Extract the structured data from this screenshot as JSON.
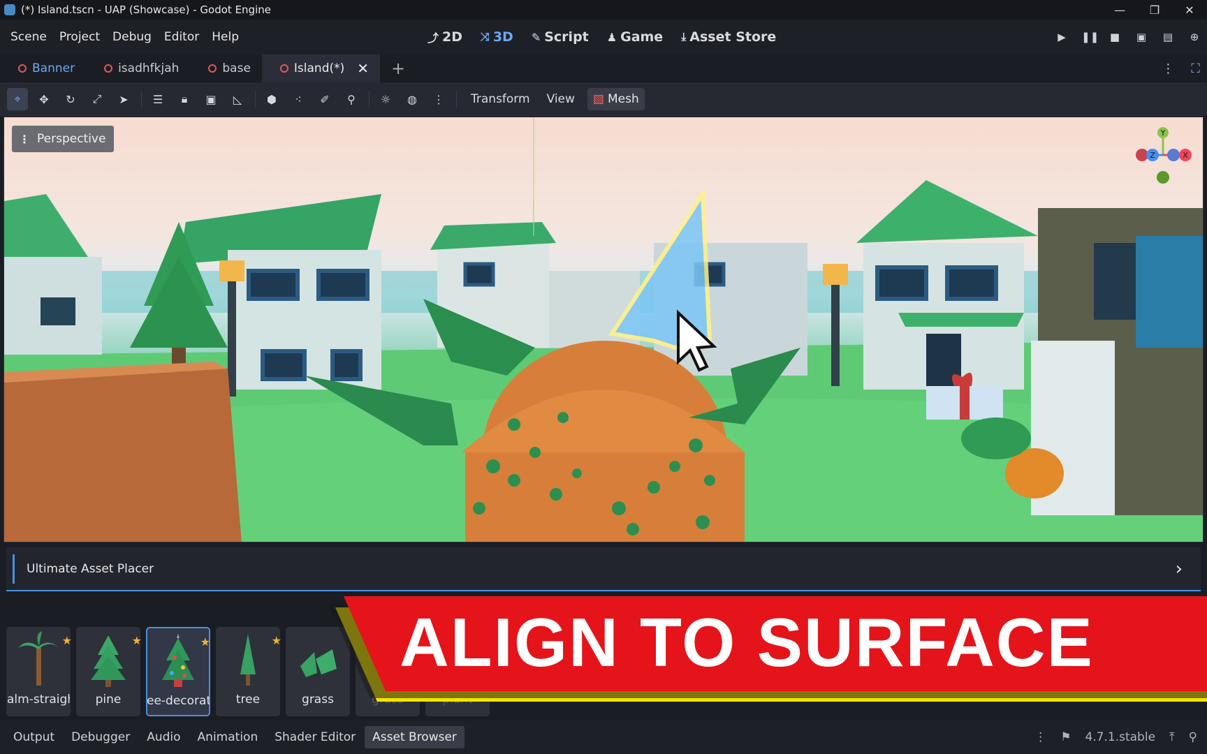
{
  "window": {
    "title": "(*) Island.tscn - UAP (Showcase) - Godot Engine"
  },
  "menu": [
    "Scene",
    "Project",
    "Debug",
    "Editor",
    "Help"
  ],
  "workspaces": [
    {
      "label": "2D",
      "icon": "2d-icon"
    },
    {
      "label": "3D",
      "icon": "3d-icon",
      "active": true
    },
    {
      "label": "Script",
      "icon": "script-icon"
    },
    {
      "label": "Game",
      "icon": "game-icon"
    },
    {
      "label": "Asset Store",
      "icon": "download-icon"
    }
  ],
  "scene_tabs": [
    {
      "label": "Banner"
    },
    {
      "label": "isadhfkjah"
    },
    {
      "label": "base"
    },
    {
      "label": "Island(*)",
      "active": true
    }
  ],
  "toolbar": {
    "transform_label": "Transform",
    "view_label": "View",
    "mesh_label": "Mesh"
  },
  "viewport": {
    "perspective_label": "Perspective",
    "gizmo": {
      "x": "X",
      "y": "Y",
      "z": "Z"
    }
  },
  "dock": {
    "title": "Ultimate Asset Placer"
  },
  "assets": [
    {
      "name": "alm-straigh",
      "favorite": true
    },
    {
      "name": "pine",
      "favorite": true
    },
    {
      "name": "ee-decorate",
      "favorite": true,
      "selected": true
    },
    {
      "name": "tree",
      "favorite": true
    },
    {
      "name": "grass",
      "favorite": false
    },
    {
      "name": "grass",
      "favorite": false
    },
    {
      "name": "plant",
      "favorite": false
    }
  ],
  "banner": {
    "text": "ALIGN TO SURFACE"
  },
  "bottom_tabs": [
    "Output",
    "Debugger",
    "Audio",
    "Animation",
    "Shader Editor",
    "Asset Browser"
  ],
  "version": "4.7.1.stable",
  "colors": {
    "accent": "#4a90e2",
    "banner_red": "#e5141a",
    "banner_yellow": "#f5e400",
    "star": "#f2b233"
  }
}
